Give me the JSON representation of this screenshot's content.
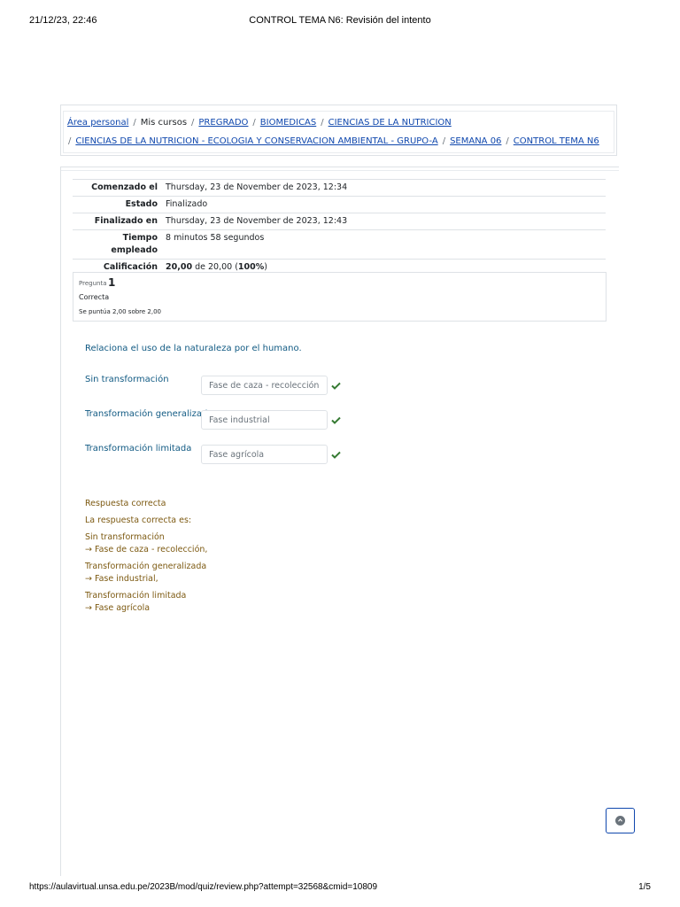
{
  "print_header": {
    "datetime": "21/12/23, 22:46",
    "title": "CONTROL TEMA N6: Revisión del intento"
  },
  "breadcrumb": {
    "items": [
      {
        "label": "Área personal",
        "link": true
      },
      {
        "label": "Mis cursos",
        "link": false
      },
      {
        "label": "PREGRADO",
        "link": true
      },
      {
        "label": "BIOMEDICAS",
        "link": true
      },
      {
        "label": "CIENCIAS DE LA NUTRICION",
        "link": true
      },
      {
        "label": "CIENCIAS DE LA NUTRICION - ECOLOGIA Y CONSERVACION AMBIENTAL - GRUPO-A",
        "link": true
      },
      {
        "label": "SEMANA 06",
        "link": true
      },
      {
        "label": "CONTROL TEMA N6",
        "link": true
      }
    ],
    "separator": "/"
  },
  "summary": {
    "started_label": "Comenzado el",
    "started_value": "Thursday, 23 de November de 2023, 12:34",
    "state_label": "Estado",
    "state_value": "Finalizado",
    "finished_label": "Finalizado en",
    "finished_value": "Thursday, 23 de November de 2023, 12:43",
    "time_label_1": "Tiempo",
    "time_label_2": "empleado",
    "time_value": "8 minutos 58 segundos",
    "grade_label": "Calificación",
    "grade_score": "20,00",
    "grade_of": " de 20,00 (",
    "grade_percent": "100%",
    "grade_close": ")"
  },
  "question": {
    "label": "Pregunta",
    "number": "1",
    "state": "Correcta",
    "grade": "Se puntúa 2,00 sobre 2,00",
    "text": "Relaciona el uso de la naturaleza por el humano.",
    "pairs": [
      {
        "label": "Sin transformación",
        "answer": "Fase de caza - recolección"
      },
      {
        "label": "Transformación generalizada",
        "answer": "Fase industrial"
      },
      {
        "label": "Transformación limitada",
        "answer": "Fase agrícola"
      }
    ]
  },
  "feedback": {
    "title": "Respuesta correcta",
    "subtitle": "La respuesta correcta es:",
    "pairs": [
      {
        "label": "Sin transformación",
        "answer": "→ Fase de caza - recolección,"
      },
      {
        "label": "Transformación generalizada",
        "answer": "→ Fase industrial,"
      },
      {
        "label": "Transformación limitada",
        "answer": "→ Fase agrícola"
      }
    ]
  },
  "print_footer": {
    "url": "https://aulavirtual.unsa.edu.pe/2023B/mod/quiz/review.php?attempt=32568&cmid=10809",
    "page": "1/5"
  },
  "colors": {
    "link": "#0f47ad",
    "question_text": "#115a83",
    "feedback_text": "#7d5a12",
    "check": "#357a32"
  },
  "icons": {
    "check": "check-icon",
    "back_to_top": "arrow-up-icon"
  }
}
